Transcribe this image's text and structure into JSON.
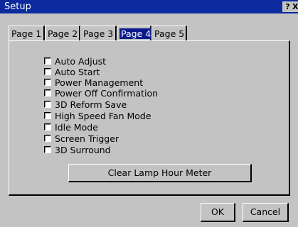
{
  "window": {
    "title": "Setup",
    "help_label": "?",
    "close_label": "X"
  },
  "tabs": [
    {
      "label": "Page 1",
      "active": false
    },
    {
      "label": "Page 2",
      "active": false
    },
    {
      "label": "Page 3",
      "active": false
    },
    {
      "label": "Page 4",
      "active": true
    },
    {
      "label": "Page 5",
      "active": false
    }
  ],
  "options": [
    {
      "label": "Auto Adjust",
      "checked": false
    },
    {
      "label": "Auto Start",
      "checked": false
    },
    {
      "label": "Power Management",
      "checked": false
    },
    {
      "label": "Power Off Confirmation",
      "checked": false
    },
    {
      "label": "3D Reform Save",
      "checked": false
    },
    {
      "label": "High Speed Fan Mode",
      "checked": false
    },
    {
      "label": "Idle Mode",
      "checked": false
    },
    {
      "label": "Screen Trigger",
      "checked": false
    },
    {
      "label": "3D Surround",
      "checked": false
    }
  ],
  "buttons": {
    "clear_lamp": "Clear Lamp Hour Meter",
    "ok": "OK",
    "cancel": "Cancel"
  },
  "colors": {
    "titlebar": "#0a2a9e",
    "active_tab": "#0a1a8e",
    "face": "#c3c3c3"
  }
}
